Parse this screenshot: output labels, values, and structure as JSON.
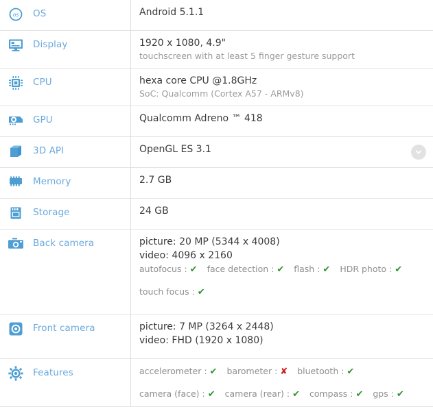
{
  "theme": {
    "label_color": "#6ba9dd",
    "value_color": "#3b3b3b",
    "sub_color": "#9b9b9b",
    "yes_color": "#2e9130",
    "no_color": "#cc2020",
    "divider_color": "#e3e3e3"
  },
  "glyphs": {
    "check": "✔",
    "cross": "✘"
  },
  "rows": [
    {
      "id": "os",
      "label": "OS",
      "icon": "os-badge-icon",
      "value": "Android 5.1.1",
      "sub": "",
      "expandable": false
    },
    {
      "id": "display",
      "label": "Display",
      "icon": "monitor-icon",
      "value": "1920 x 1080, 4.9\"",
      "sub": "touchscreen with at least 5 finger gesture support",
      "expandable": false
    },
    {
      "id": "cpu",
      "label": "CPU",
      "icon": "cpu-chip-icon",
      "value": "hexa core CPU @1.8GHz",
      "sub": "SoC: Qualcomm (Cortex A57 - ARMv8)",
      "expandable": false
    },
    {
      "id": "gpu",
      "label": "GPU",
      "icon": "graphics-card-icon",
      "value": "Qualcomm Adreno ™ 418",
      "sub": "",
      "expandable": false
    },
    {
      "id": "3d-api",
      "label": "3D API",
      "icon": "cube-icon",
      "value": "OpenGL ES 3.1",
      "sub": "",
      "expandable": true,
      "expand_icon": "chevron-down-icon"
    },
    {
      "id": "memory",
      "label": "Memory",
      "icon": "memory-module-icon",
      "value": "2.7 GB",
      "sub": "",
      "expandable": false
    },
    {
      "id": "storage",
      "label": "Storage",
      "icon": "storage-card-icon",
      "value": "24 GB",
      "sub": "",
      "expandable": false
    }
  ],
  "back_camera": {
    "label": "Back camera",
    "icon": "camera-icon",
    "picture": "picture: 20 MP (5344 x 4008)",
    "video": "video: 4096 x 2160",
    "features_line1": [
      {
        "name": "autofocus",
        "supported": true
      },
      {
        "name": "face detection",
        "supported": true
      },
      {
        "name": "flash",
        "supported": true
      },
      {
        "name": "HDR photo",
        "supported": true
      }
    ],
    "features_line2": [
      {
        "name": "touch focus",
        "supported": true
      }
    ]
  },
  "front_camera": {
    "label": "Front camera",
    "icon": "front-camera-icon",
    "picture": "picture: 7 MP (3264 x 2448)",
    "video": "video: FHD (1920 x 1080)"
  },
  "features": {
    "label": "Features",
    "icon": "gear-icon",
    "line1": [
      {
        "name": "accelerometer",
        "supported": true
      },
      {
        "name": "barometer",
        "supported": false
      },
      {
        "name": "bluetooth",
        "supported": true
      }
    ],
    "line2": [
      {
        "name": "camera (face)",
        "supported": true
      },
      {
        "name": "camera (rear)",
        "supported": true
      },
      {
        "name": "compass",
        "supported": true
      },
      {
        "name": "gps",
        "supported": true
      }
    ]
  }
}
